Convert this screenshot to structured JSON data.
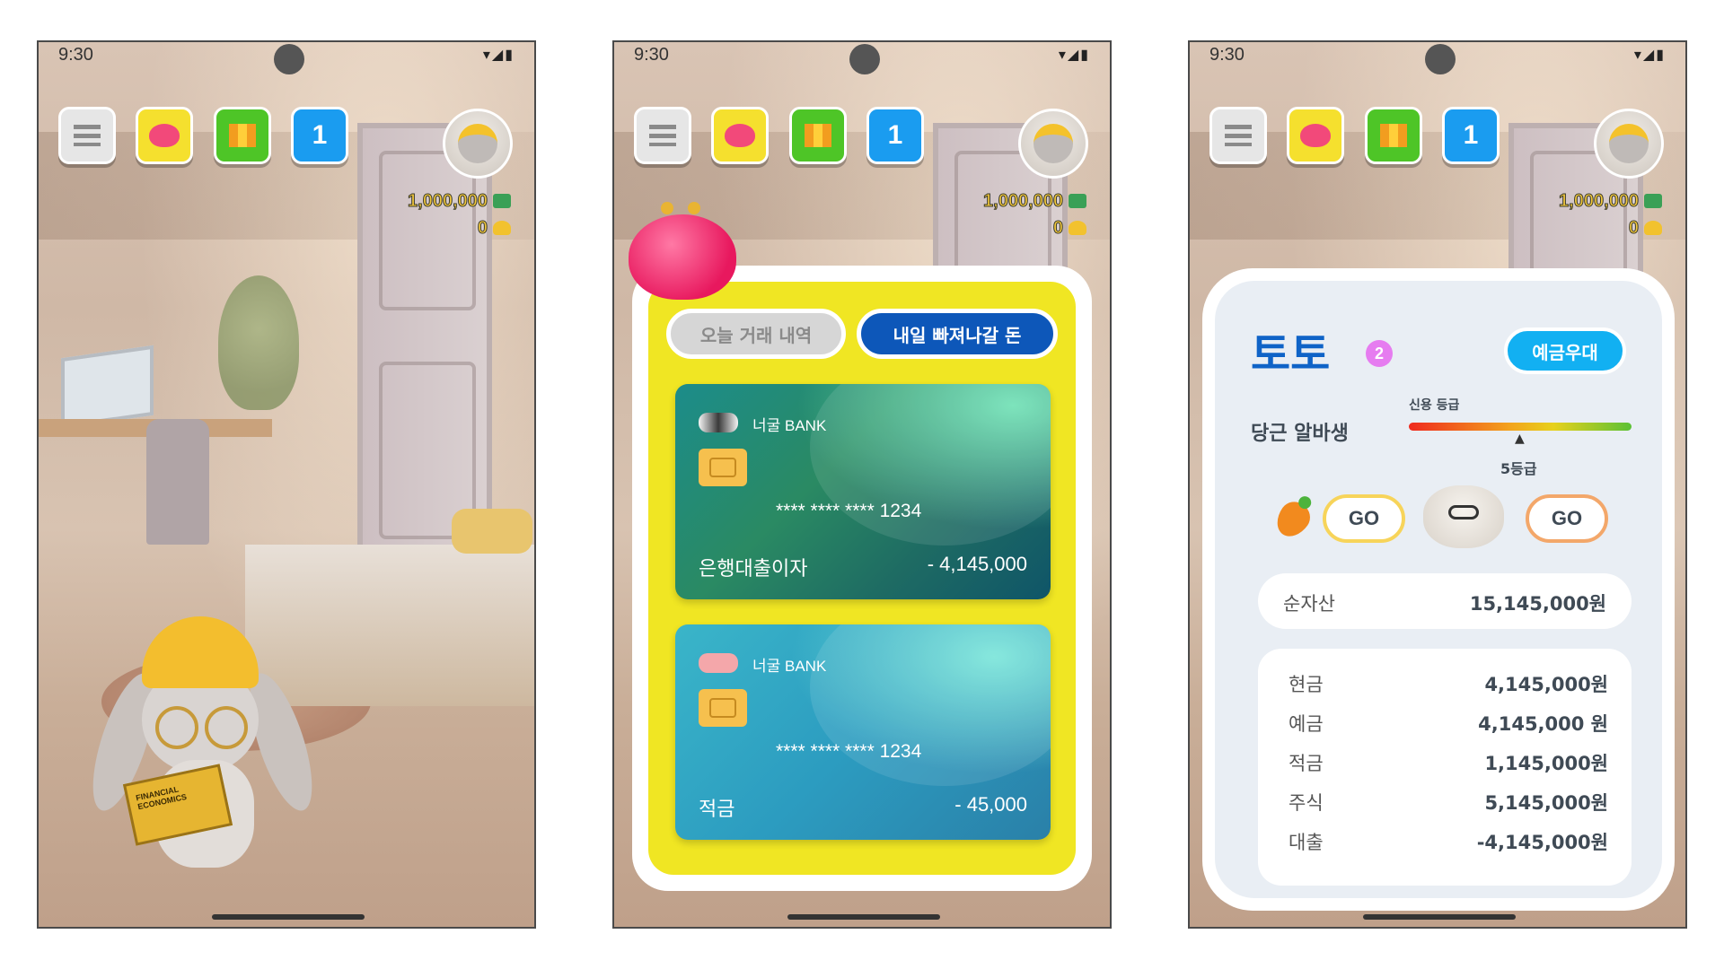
{
  "status": {
    "time": "9:30",
    "icons": "▾◢▮"
  },
  "hud": {
    "menu_icon": "hamburger-icon",
    "wallet_icon": "purse-icon",
    "map_icon": "map-icon",
    "level_badge": "1",
    "money": "1,000,000",
    "coins": "0"
  },
  "screen1": {
    "book_title": "FINANCIAL ECONOMICS"
  },
  "screen2": {
    "tabs": [
      {
        "label": "오늘 거래 내역",
        "active": false
      },
      {
        "label": "내일 빠져나갈 돈",
        "active": true
      }
    ],
    "cards": [
      {
        "bank": "너굴 BANK",
        "number": "**** **** **** 1234",
        "label": "은행대출이자",
        "amount": "- 4,145,000"
      },
      {
        "bank": "너굴 BANK",
        "number": "**** **** **** 1234",
        "label": "적금",
        "amount": "- 45,000"
      }
    ]
  },
  "screen3": {
    "name": "토토",
    "level": "2",
    "deposit_button": "예금우대",
    "job": "당근 알바생",
    "credit_label": "신용 등급",
    "credit_marker": "▲",
    "credit_grade": "5등급",
    "credit_position": 0.5,
    "go_labels": [
      "GO",
      "GO"
    ],
    "net_worth": {
      "label": "순자산",
      "value": "15,145,000원"
    },
    "assets": [
      {
        "label": "현금",
        "value": "4,145,000원"
      },
      {
        "label": "예금",
        "value": "4,145,000 원"
      },
      {
        "label": "적금",
        "value": "1,145,000원"
      },
      {
        "label": "주식",
        "value": "5,145,000원"
      },
      {
        "label": "대출",
        "value": "-4,145,000원"
      }
    ]
  },
  "colors": {
    "yellow_panel": "#f0e623",
    "tab_active": "#0d57b9",
    "name_blue": "#0f63c7",
    "deposit_blue": "#12b0f2"
  }
}
